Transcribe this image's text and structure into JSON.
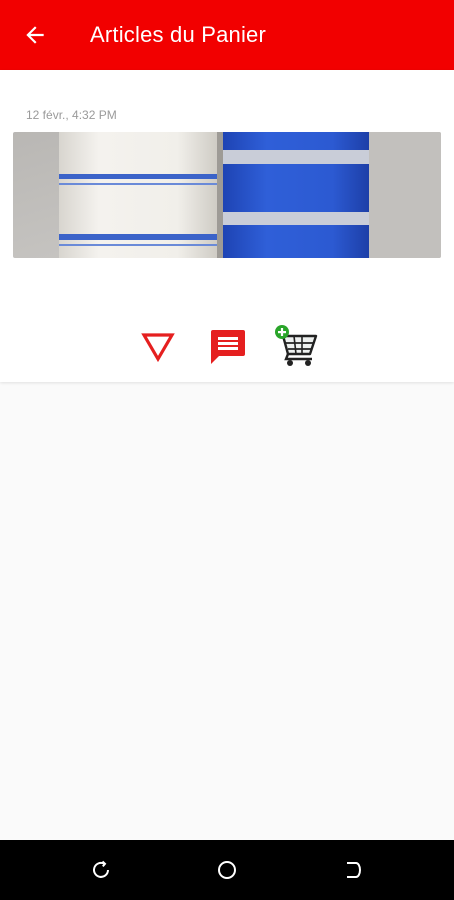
{
  "appbar": {
    "title": "Articles du Panier",
    "back_icon": "arrow-left-icon",
    "background_color": "#f20000"
  },
  "item": {
    "timestamp": "12 févr., 4:32 PM",
    "image_description_icon": "fabric-rolls-photo"
  },
  "actions": {
    "filter_icon": "triangle-down-icon",
    "message_icon": "chat-message-icon",
    "cart_icon": "add-to-cart-icon",
    "accent_color": "#e51f1f",
    "cart_plus_color": "#2aa52a"
  },
  "navbar": {
    "recent_icon": "recent-apps-icon",
    "home_icon": "home-circle-icon",
    "back_icon": "back-nav-icon"
  }
}
